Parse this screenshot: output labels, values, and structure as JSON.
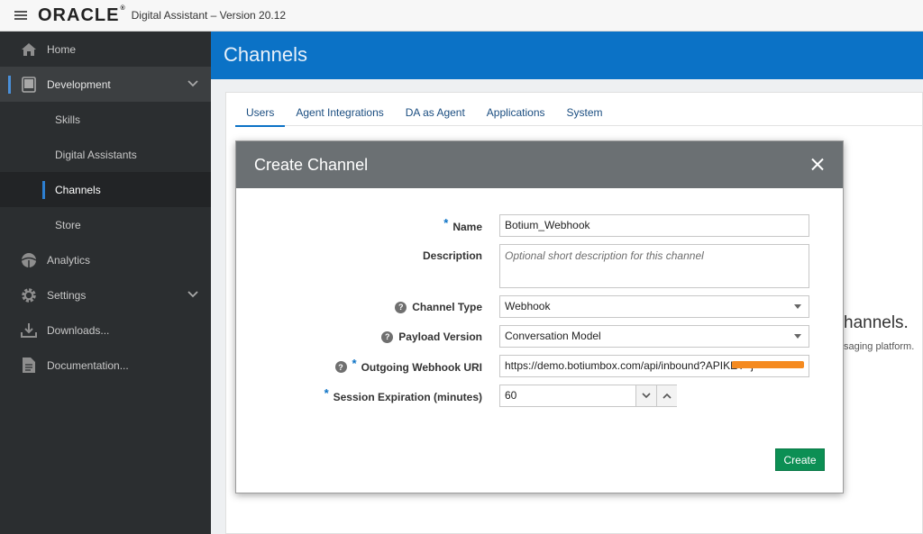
{
  "topbar": {
    "logo": "ORACLE",
    "logo_mark": "®",
    "product": "Digital Assistant – Version 20.12"
  },
  "sidebar": {
    "items": [
      {
        "label": "Home",
        "icon": "home-icon"
      },
      {
        "label": "Development",
        "icon": "tablet-icon"
      },
      {
        "label": "Skills"
      },
      {
        "label": "Digital Assistants"
      },
      {
        "label": "Channels"
      },
      {
        "label": "Store"
      },
      {
        "label": "Analytics",
        "icon": "analytics-icon"
      },
      {
        "label": "Settings",
        "icon": "gear-icon"
      },
      {
        "label": "Downloads...",
        "icon": "download-icon"
      },
      {
        "label": "Documentation...",
        "icon": "document-icon"
      }
    ]
  },
  "page": {
    "title": "Channels",
    "tabs": [
      "Users",
      "Agent Integrations",
      "DA as Agent",
      "Applications",
      "System"
    ],
    "selected_tab": "Users",
    "background_heading": "hannels.",
    "background_sub": "saging platform."
  },
  "modal": {
    "title": "Create Channel",
    "fields": {
      "name": {
        "label": "Name",
        "value": "Botium_Webhook"
      },
      "description": {
        "label": "Description",
        "placeholder": "Optional short description for this channel"
      },
      "channel_type": {
        "label": "Channel Type",
        "value": "Webhook"
      },
      "payload_version": {
        "label": "Payload Version",
        "value": "Conversation Model"
      },
      "webhook_uri": {
        "label": "Outgoing Webhook URI",
        "value": "https://demo.botiumbox.com/api/inbound?APIKEY=j"
      },
      "session_expiration": {
        "label": "Session Expiration (minutes)",
        "value": "60"
      }
    },
    "required_mark": "*",
    "help_mark": "?",
    "create_label": "Create"
  },
  "colors": {
    "brand_blue": "#0b72c6",
    "sidebar_bg": "#2b2e30",
    "create_green": "#0c8f54",
    "redaction": "#f58a1f"
  }
}
